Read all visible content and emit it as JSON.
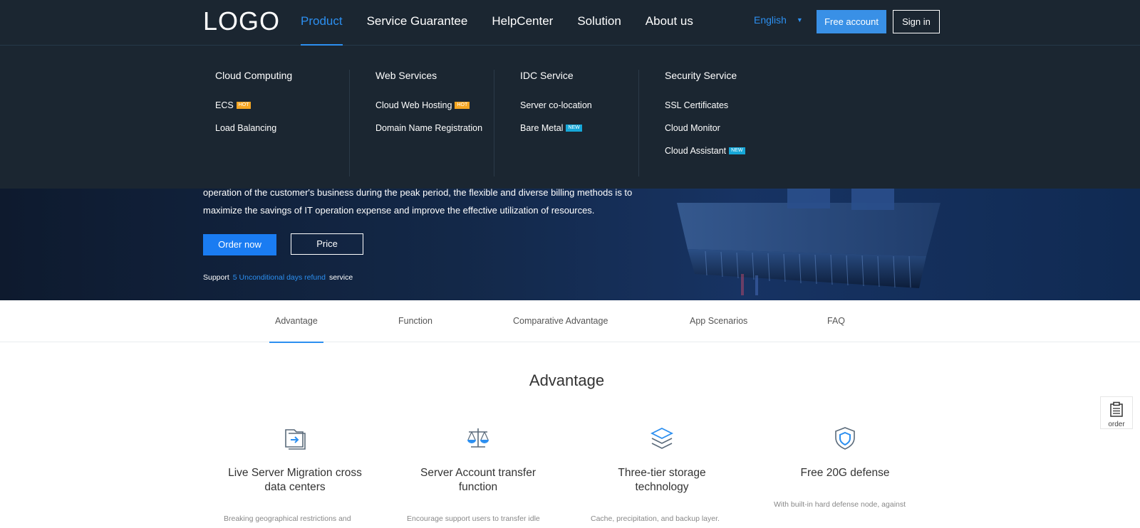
{
  "header": {
    "logo": "LOGO",
    "nav": [
      "Product",
      "Service Guarantee",
      "HelpCenter",
      "Solution",
      "About us"
    ],
    "language": "English",
    "free_account": "Free account",
    "sign_in": "Sign in"
  },
  "menu": {
    "columns": [
      {
        "title": "Cloud Computing",
        "items": [
          {
            "label": "ECS",
            "tag": "HOT"
          },
          {
            "label": "Load Balancing",
            "tag": ""
          }
        ]
      },
      {
        "title": "Web Services",
        "items": [
          {
            "label": "Cloud Web Hosting",
            "tag": "HOT"
          },
          {
            "label": "Domain Name Registration",
            "tag": ""
          }
        ]
      },
      {
        "title": "IDC Service",
        "items": [
          {
            "label": "Server co-location",
            "tag": ""
          },
          {
            "label": "Bare Metal",
            "tag": "NEW"
          }
        ]
      },
      {
        "title": "Security Service",
        "items": [
          {
            "label": "SSL Certificates",
            "tag": ""
          },
          {
            "label": "Cloud Monitor",
            "tag": ""
          },
          {
            "label": "Cloud Assistant",
            "tag": "NEW"
          }
        ]
      }
    ]
  },
  "hero": {
    "text_line1": "operation of the customer's business during the peak period, the flexible and diverse billing methods is to",
    "text_line2": "maximize the savings of IT operation expense and improve the effective utilization of resources.",
    "order_now": "Order now",
    "price": "Price",
    "support_prefix": "Support",
    "support_link": "5 Unconditional days refund",
    "support_suffix": "service"
  },
  "subnav": {
    "tabs": [
      "Advantage",
      "Function",
      "Comparative Advantage",
      "App Scenarios",
      "FAQ"
    ]
  },
  "advantage": {
    "title": "Advantage",
    "cards": [
      {
        "title": "Live Server Migration cross data centers",
        "desc": "Breaking geographical restrictions and"
      },
      {
        "title": "Server Account transfer function",
        "desc": "Encourage support users to transfer idle"
      },
      {
        "title": "Three-tier storage technology",
        "desc": "Cache, precipitation, and backup layer."
      },
      {
        "title": "Free 20G defense",
        "desc": "With built-in hard defense node, against"
      }
    ]
  },
  "float": {
    "order": "order"
  },
  "colors": {
    "accent": "#2c8ff0",
    "header_bg": "#1b2631",
    "hot_tag": "#f5a623",
    "new_tag": "#16a7d8",
    "order_btn": "#1a7cf2"
  },
  "icons": [
    "migration-icon",
    "balance-scale-icon",
    "layers-icon",
    "shield-icon",
    "clipboard-icon",
    "caret-down-icon"
  ]
}
